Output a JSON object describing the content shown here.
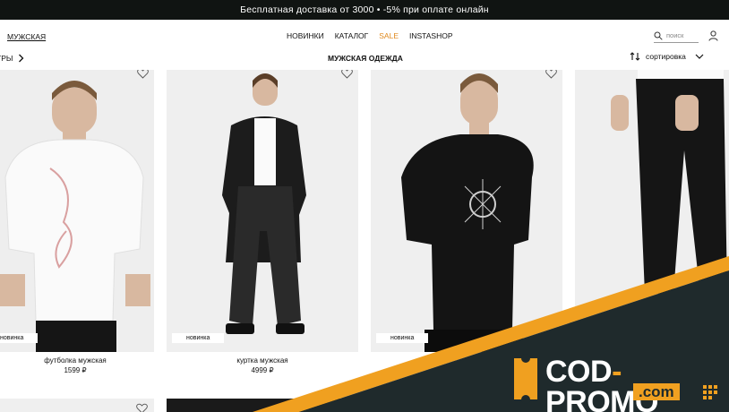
{
  "promo_bar": {
    "text": "Бесплатная доставка от 3000 • -5% при оплате онлайн"
  },
  "header": {
    "gender_link": "МУЖСКАЯ",
    "nav": [
      "НОВИНКИ",
      "КАТАЛОГ",
      "SALE",
      "INSTASHOP"
    ],
    "search_placeholder": "поиск"
  },
  "toolbar": {
    "filters_label": "ТРЫ",
    "page_title": "МУЖСКАЯ ОДЕЖДА",
    "sort_label": "сортировка"
  },
  "products": [
    {
      "name": "футболка мужская",
      "price": "1599 ₽",
      "badge": "новинка"
    },
    {
      "name": "куртка мужская",
      "price": "4999 ₽",
      "badge": "новинка"
    },
    {
      "name": "",
      "price": "",
      "badge": "новинка"
    },
    {
      "name": "",
      "price": "",
      "badge": ""
    }
  ],
  "logo": {
    "main": "COD",
    "dash": "-",
    "main2": "PROMO",
    "sub": ".com"
  },
  "colors": {
    "promo_bar_bg": "#101412",
    "sale": "#e08a1e",
    "brand_orange": "#f0a020",
    "banner_dark": "#1f2a2c"
  }
}
